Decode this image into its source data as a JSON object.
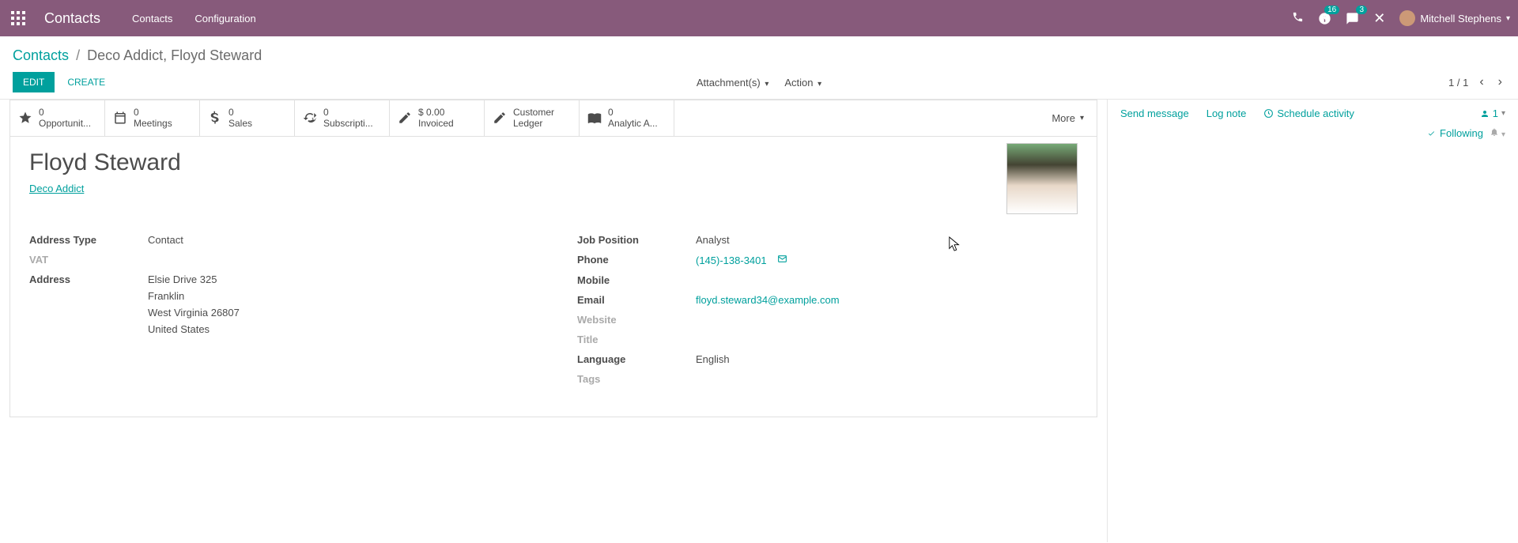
{
  "header": {
    "app_name": "Contacts",
    "nav": [
      "Contacts",
      "Configuration"
    ],
    "notif_badge": "16",
    "chat_badge": "3",
    "user_name": "Mitchell Stephens"
  },
  "breadcrumb": {
    "root": "Contacts",
    "current": "Deco Addict, Floyd Steward"
  },
  "buttons": {
    "edit": "EDIT",
    "create": "CREATE",
    "attachments": "Attachment(s)",
    "action": "Action",
    "more": "More"
  },
  "pager": {
    "text": "1 / 1"
  },
  "stat_buttons": [
    {
      "value": "0",
      "label": "Opportunit..."
    },
    {
      "value": "0",
      "label": "Meetings"
    },
    {
      "value": "0",
      "label": "Sales"
    },
    {
      "value": "0",
      "label": "Subscripti..."
    },
    {
      "value": "$ 0.00",
      "label": "Invoiced"
    },
    {
      "value": "",
      "label": "Customer Ledger"
    },
    {
      "value": "0",
      "label": "Analytic A..."
    }
  ],
  "contact": {
    "name": "Floyd Steward",
    "company": "Deco Addict"
  },
  "fields_left": {
    "address_type_label": "Address Type",
    "address_type_value": "Contact",
    "vat_label": "VAT",
    "address_label": "Address",
    "address": {
      "line1": "Elsie Drive  325",
      "line2": "Franklin",
      "line3": "West Virginia  26807",
      "line4": "United States"
    }
  },
  "fields_right": {
    "job_label": "Job Position",
    "job_value": "Analyst",
    "phone_label": "Phone",
    "phone_value": "(145)-138-3401",
    "mobile_label": "Mobile",
    "email_label": "Email",
    "email_value": "floyd.steward34@example.com",
    "website_label": "Website",
    "title_label": "Title",
    "language_label": "Language",
    "language_value": "English",
    "tags_label": "Tags"
  },
  "chatter": {
    "send_message": "Send message",
    "log_note": "Log note",
    "schedule": "Schedule activity",
    "follower_count": "1",
    "following": "Following"
  }
}
